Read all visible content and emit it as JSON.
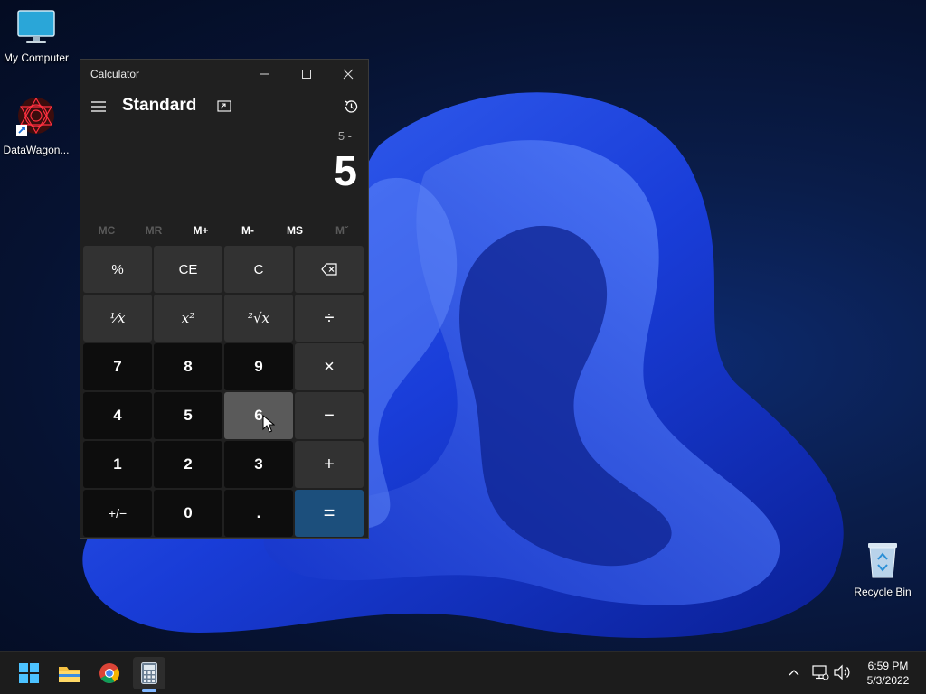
{
  "desktop": {
    "icons": [
      {
        "label": "My Computer",
        "icon": "monitor-icon"
      },
      {
        "label": "DataWagon...",
        "icon": "datawagon-icon"
      },
      {
        "label": "Recycle Bin",
        "icon": "recycle-bin-icon"
      }
    ]
  },
  "calculator": {
    "window_title": "Calculator",
    "mode": "Standard",
    "expression": "5 -",
    "result": "5",
    "memory_buttons": [
      {
        "label": "MC",
        "enabled": false
      },
      {
        "label": "MR",
        "enabled": false
      },
      {
        "label": "M+",
        "enabled": true
      },
      {
        "label": "M-",
        "enabled": true
      },
      {
        "label": "MS",
        "enabled": true
      },
      {
        "label": "Mˇ",
        "enabled": false
      }
    ],
    "keys": [
      {
        "label": "%",
        "name": "percent-key"
      },
      {
        "label": "CE",
        "name": "clear-entry-key"
      },
      {
        "label": "C",
        "name": "clear-key"
      },
      {
        "label": "⌫",
        "name": "backspace-key"
      },
      {
        "label": "⅟x",
        "name": "reciprocal-key"
      },
      {
        "label": "x²",
        "name": "square-key"
      },
      {
        "label": "²√x",
        "name": "square-root-key"
      },
      {
        "label": "÷",
        "name": "divide-key"
      },
      {
        "label": "7",
        "name": "digit-7-key"
      },
      {
        "label": "8",
        "name": "digit-8-key"
      },
      {
        "label": "9",
        "name": "digit-9-key"
      },
      {
        "label": "×",
        "name": "multiply-key"
      },
      {
        "label": "4",
        "name": "digit-4-key"
      },
      {
        "label": "5",
        "name": "digit-5-key"
      },
      {
        "label": "6",
        "name": "digit-6-key"
      },
      {
        "label": "−",
        "name": "subtract-key"
      },
      {
        "label": "1",
        "name": "digit-1-key"
      },
      {
        "label": "2",
        "name": "digit-2-key"
      },
      {
        "label": "3",
        "name": "digit-3-key"
      },
      {
        "label": "+",
        "name": "add-key"
      },
      {
        "label": "+/−",
        "name": "negate-key"
      },
      {
        "label": "0",
        "name": "digit-0-key"
      },
      {
        "label": ".",
        "name": "decimal-key"
      },
      {
        "label": "=",
        "name": "equals-key"
      }
    ],
    "hovered_key": "6"
  },
  "taskbar": {
    "apps": [
      "start-icon",
      "file-explorer-icon",
      "chrome-icon",
      "calculator-icon"
    ],
    "active_app": "calculator-icon",
    "time": "6:59 PM",
    "date": "5/3/2022",
    "accent_color": "#7fb6ff"
  },
  "colors": {
    "equals_key": "#1c4f7c",
    "window_bg": "#202020"
  }
}
